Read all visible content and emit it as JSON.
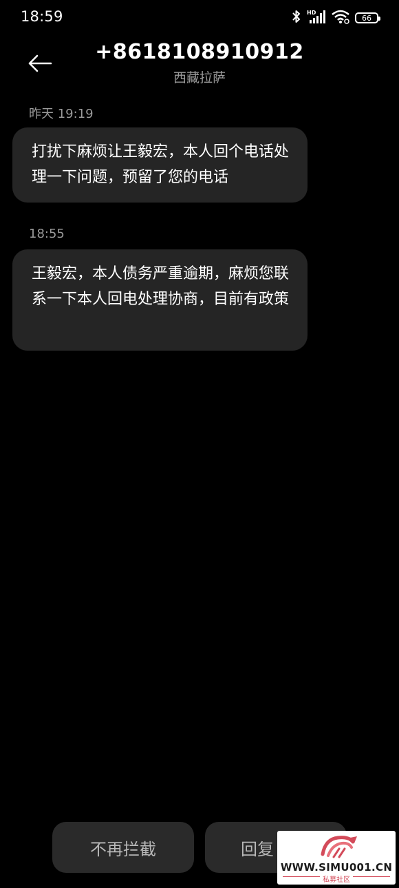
{
  "status_bar": {
    "time": "18:59",
    "battery": "66",
    "icons": [
      "bluetooth-icon",
      "hd-signal-icon",
      "wifi-icon",
      "battery-icon"
    ]
  },
  "header": {
    "contact_number": "+8618108910912",
    "location": "西藏拉萨"
  },
  "messages": [
    {
      "timestamp": "昨天 19:19",
      "text": "打扰下麻烦让王毅宏，本人回个电话处理一下问题，预留了您的电话"
    },
    {
      "timestamp": "18:55",
      "text": "王毅宏，本人债务严重逾期，麻烦您联系一下本人回电处理协商，目前有政策"
    }
  ],
  "bottom_actions": {
    "unblock_label": "不再拦截",
    "reply_label": "回复"
  },
  "watermark": {
    "url": "WWW.SIMU001.CN",
    "name": "私募社区"
  }
}
